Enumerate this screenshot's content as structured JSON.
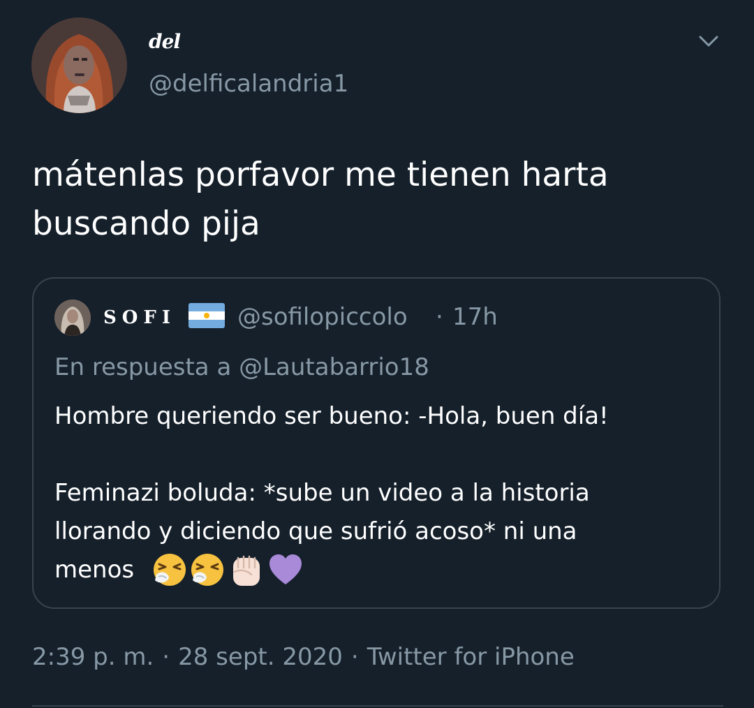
{
  "author": {
    "display_name": "del",
    "handle": "@delficalandria1"
  },
  "tweet": {
    "text": "mátenlas porfavor me tienen harta\nbuscando pija"
  },
  "quoted_tweet": {
    "display_name": "SOFI",
    "handle": "@sofilopiccolo",
    "separator": "·",
    "time": "17h",
    "reply_prefix": "En respuesta a",
    "reply_to": "@Lautabarrio18",
    "text": "Hombre queriendo ser bueno: -Hola, buen día!\n\nFeminazi boluda: *sube un video a la historia\nllorando y diciendo que sufrió acoso* ni una\nmenos",
    "emojis": [
      "sneezing-face",
      "sneezing-face",
      "raised-fist-light-skin",
      "purple-heart"
    ]
  },
  "meta": {
    "time": "2:39 p. m.",
    "date": "28 sept. 2020",
    "source": "Twitter for iPhone",
    "separator": "·"
  },
  "colors": {
    "background": "#15202b",
    "text_primary": "#ffffff",
    "text_secondary": "#8899a6",
    "border": "#38444d"
  }
}
